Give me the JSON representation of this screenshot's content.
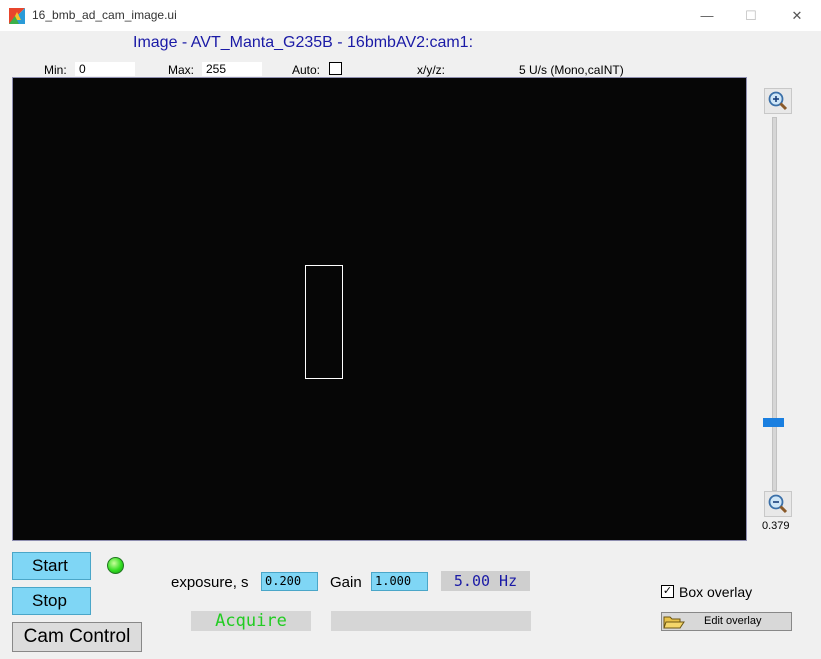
{
  "window": {
    "title": "16_bmb_ad_cam_image.ui",
    "minimize_symbol": "—",
    "maximize_symbol": "☐",
    "close_symbol": "✕"
  },
  "header": {
    "image_title": "Image - AVT_Manta_G235B - 16bmbAV2:cam1:"
  },
  "controls_row": {
    "min_label": "Min:",
    "min_value": "0",
    "max_label": "Max:",
    "max_value": "255",
    "auto_label": "Auto:",
    "auto_checked": false,
    "xyz_label": "x/y/z:",
    "mode_text": "5 U/s (Mono,caINT)"
  },
  "zoom": {
    "value": "0.379",
    "zoom_in_icon": "zoom-in-icon",
    "zoom_out_icon": "zoom-out-icon",
    "slider_level_fraction": 0.82
  },
  "buttons": {
    "start": "Start",
    "stop": "Stop",
    "cam_control": "Cam Control",
    "edit_overlay": "Edit overlay"
  },
  "acquisition": {
    "exposure_label": "exposure, s",
    "exposure_value": "0.200",
    "gain_label": "Gain",
    "gain_value": "1.000",
    "rate": "5.00 Hz",
    "status": "Acquire",
    "status_led_color": "#33dd22"
  },
  "overlay": {
    "box_overlay_label": "Box overlay",
    "box_overlay_checked": true
  },
  "colors": {
    "title_blue": "#1a1aa6",
    "button_cyan": "#7fd6f5",
    "acquire_green": "#22cc22",
    "slider_blue": "#1a7fe0"
  }
}
